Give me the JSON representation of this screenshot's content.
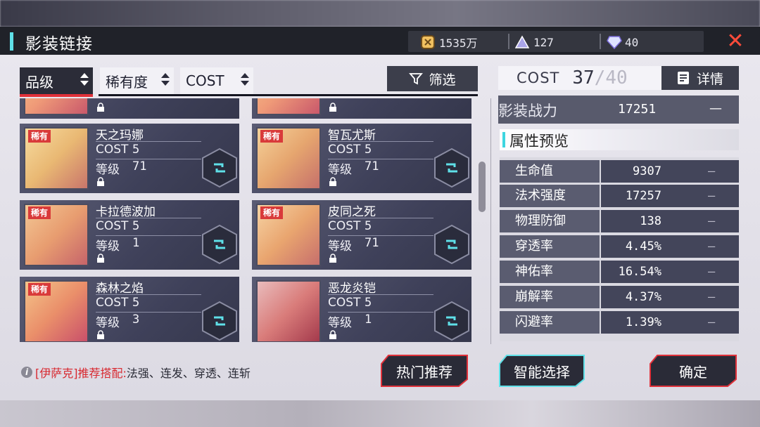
{
  "header": {
    "title": "影装链接",
    "currencies": [
      {
        "icon": "gold-coin-icon",
        "value": "1535万"
      },
      {
        "icon": "triangle-crystal-icon",
        "value": "127"
      },
      {
        "icon": "diamond-icon",
        "value": "40"
      }
    ],
    "close_icon": "close-icon"
  },
  "filters": {
    "items": [
      "品级",
      "稀有度",
      "COST"
    ],
    "active_index": 0,
    "filter_button": "筛选"
  },
  "cards": [
    {
      "name": "天之玛娜",
      "badge": "稀有",
      "cost_label": "COST",
      "cost": "5",
      "level_label": "等级",
      "level": "71",
      "art_color": "#e9b873"
    },
    {
      "name": "智瓦尤斯",
      "badge": "稀有",
      "cost_label": "COST",
      "cost": "5",
      "level_label": "等级",
      "level": "71",
      "art_color": "#e6a66f"
    },
    {
      "name": "卡拉德波加",
      "badge": "稀有",
      "cost_label": "COST",
      "cost": "5",
      "level_label": "等级",
      "level": "1",
      "art_color": "#e89d70"
    },
    {
      "name": "皮同之死",
      "badge": "稀有",
      "cost_label": "COST",
      "cost": "5",
      "level_label": "等级",
      "level": "71",
      "art_color": "#e9a56f"
    },
    {
      "name": "森林之焰",
      "badge": "稀有",
      "cost_label": "COST",
      "cost": "5",
      "level_label": "等级",
      "level": "3",
      "art_color": "#ea8f6a"
    },
    {
      "name": "恶龙炎铠",
      "badge": "",
      "cost_label": "COST",
      "cost": "5",
      "level_label": "等级",
      "level": "1",
      "art_color": "#d97c7a"
    }
  ],
  "cost": {
    "label": "COST",
    "current": "37",
    "max": "/40"
  },
  "detail_button": "详情",
  "power": {
    "label": "影装战力",
    "value": "17251",
    "delta": "—"
  },
  "attributes": {
    "title": "属性预览",
    "rows": [
      {
        "name": "生命值",
        "value": "9307",
        "delta": "—"
      },
      {
        "name": "法术强度",
        "value": "17257",
        "delta": "—"
      },
      {
        "name": "物理防御",
        "value": "138",
        "delta": "—"
      },
      {
        "name": "穿透率",
        "value": "4.45%",
        "delta": "—"
      },
      {
        "name": "神佑率",
        "value": "16.54%",
        "delta": "—"
      },
      {
        "name": "崩解率",
        "value": "4.37%",
        "delta": "—"
      },
      {
        "name": "闪避率",
        "value": "1.39%",
        "delta": "—"
      }
    ]
  },
  "recommendation": {
    "hero": "[伊萨克]推荐搭配:",
    "text": "法强、连发、穿透、连斩"
  },
  "buttons": {
    "hot": "热门推荐",
    "smart": "智能选择",
    "confirm": "确定"
  },
  "colors": {
    "accent_cyan": "#5fe0e8",
    "accent_red": "#e0313a",
    "panel_dark": "#3c3e4b"
  }
}
